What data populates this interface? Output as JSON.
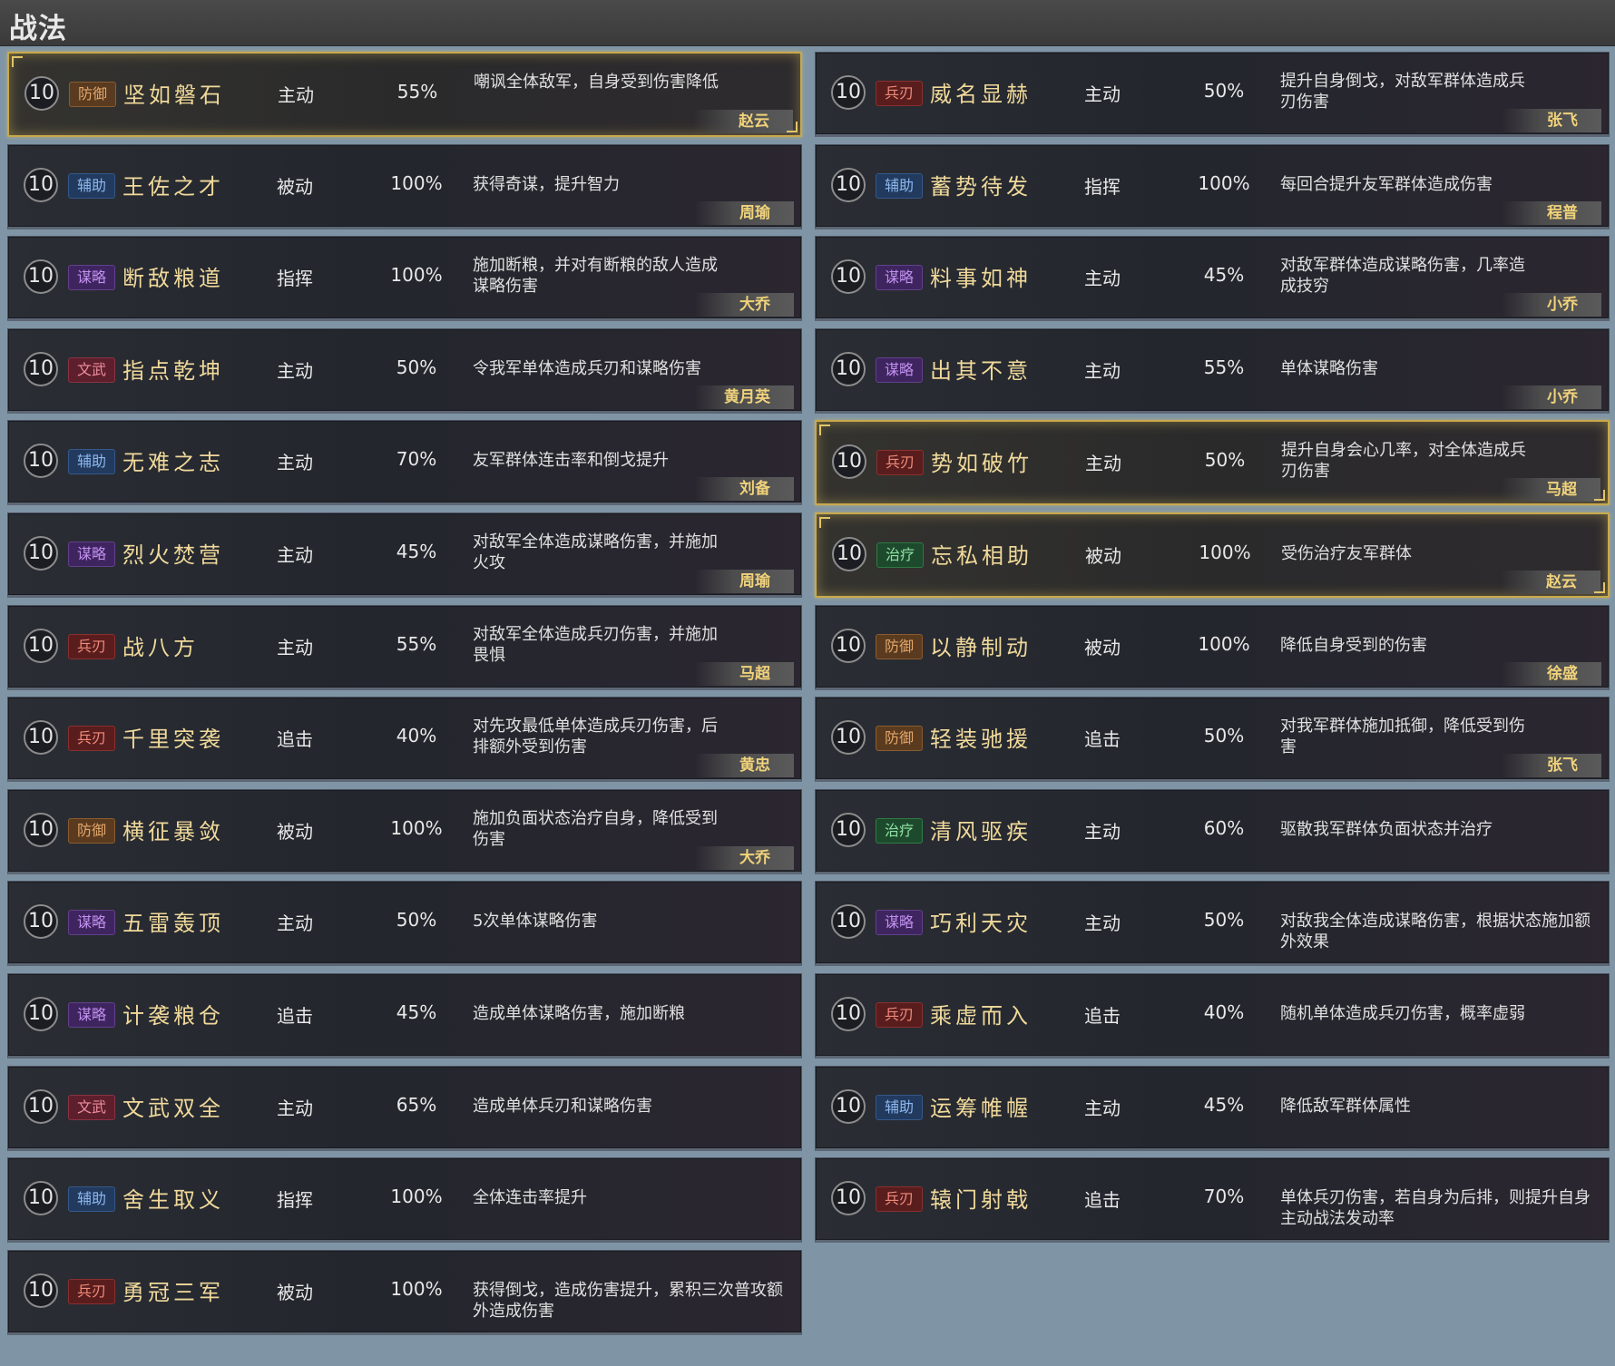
{
  "header": {
    "title": "战法"
  },
  "left": [
    {
      "level": "10",
      "tag": "防御",
      "tagKind": "fangyu",
      "name": "坚如磐石",
      "type": "主动",
      "rate": "55%",
      "desc": "嘲讽全体敌军，自身受到伤害降低",
      "hero": "赵云",
      "selected": true
    },
    {
      "level": "10",
      "tag": "辅助",
      "tagKind": "fuzhu",
      "name": "王佐之才",
      "type": "被动",
      "rate": "100%",
      "desc": "获得奇谋，提升智力",
      "hero": "周瑜",
      "selected": false
    },
    {
      "level": "10",
      "tag": "谋略",
      "tagKind": "moulue",
      "name": "断敌粮道",
      "type": "指挥",
      "rate": "100%",
      "desc": "施加断粮，并对有断粮的敌人造成谋略伤害",
      "hero": "大乔",
      "selected": false
    },
    {
      "level": "10",
      "tag": "文武",
      "tagKind": "wenwu",
      "name": "指点乾坤",
      "type": "主动",
      "rate": "50%",
      "desc": "令我军单体造成兵刃和谋略伤害",
      "hero": "黄月英",
      "selected": false
    },
    {
      "level": "10",
      "tag": "辅助",
      "tagKind": "fuzhu",
      "name": "无难之志",
      "type": "主动",
      "rate": "70%",
      "desc": "友军群体连击率和倒戈提升",
      "hero": "刘备",
      "selected": false
    },
    {
      "level": "10",
      "tag": "谋略",
      "tagKind": "moulue",
      "name": "烈火焚营",
      "type": "主动",
      "rate": "45%",
      "desc": "对敌军全体造成谋略伤害，并施加火攻",
      "hero": "周瑜",
      "selected": false
    },
    {
      "level": "10",
      "tag": "兵刃",
      "tagKind": "bingren",
      "name": "战八方",
      "type": "主动",
      "rate": "55%",
      "desc": "对敌军全体造成兵刃伤害，并施加畏惧",
      "hero": "马超",
      "selected": false
    },
    {
      "level": "10",
      "tag": "兵刃",
      "tagKind": "bingren",
      "name": "千里突袭",
      "type": "追击",
      "rate": "40%",
      "desc": "对先攻最低单体造成兵刃伤害，后排额外受到伤害",
      "hero": "黄忠",
      "selected": false
    },
    {
      "level": "10",
      "tag": "防御",
      "tagKind": "fangyu",
      "name": "横征暴敛",
      "type": "被动",
      "rate": "100%",
      "desc": "施加负面状态治疗自身，降低受到伤害",
      "hero": "大乔",
      "selected": false
    },
    {
      "level": "10",
      "tag": "谋略",
      "tagKind": "moulue",
      "name": "五雷轰顶",
      "type": "主动",
      "rate": "50%",
      "desc": "5次单体谋略伤害",
      "hero": "",
      "selected": false
    },
    {
      "level": "10",
      "tag": "谋略",
      "tagKind": "moulue",
      "name": "计袭粮仓",
      "type": "追击",
      "rate": "45%",
      "desc": "造成单体谋略伤害，施加断粮",
      "hero": "",
      "selected": false
    },
    {
      "level": "10",
      "tag": "文武",
      "tagKind": "wenwu",
      "name": "文武双全",
      "type": "主动",
      "rate": "65%",
      "desc": "造成单体兵刃和谋略伤害",
      "hero": "",
      "selected": false
    },
    {
      "level": "10",
      "tag": "辅助",
      "tagKind": "fuzhu",
      "name": "舍生取义",
      "type": "指挥",
      "rate": "100%",
      "desc": "全体连击率提升",
      "hero": "",
      "selected": false
    },
    {
      "level": "10",
      "tag": "兵刃",
      "tagKind": "bingren",
      "name": "勇冠三军",
      "type": "被动",
      "rate": "100%",
      "desc": "获得倒戈，造成伤害提升，累积三次普攻额外造成伤害",
      "hero": "",
      "selected": false
    }
  ],
  "right": [
    {
      "level": "10",
      "tag": "兵刃",
      "tagKind": "bingren",
      "name": "威名显赫",
      "type": "主动",
      "rate": "50%",
      "desc": "提升自身倒戈，对敌军群体造成兵刃伤害",
      "hero": "张飞",
      "selected": false
    },
    {
      "level": "10",
      "tag": "辅助",
      "tagKind": "fuzhu",
      "name": "蓄势待发",
      "type": "指挥",
      "rate": "100%",
      "desc": "每回合提升友军群体造成伤害",
      "hero": "程普",
      "selected": false
    },
    {
      "level": "10",
      "tag": "谋略",
      "tagKind": "moulue",
      "name": "料事如神",
      "type": "主动",
      "rate": "45%",
      "desc": "对敌军群体造成谋略伤害，几率造成技穷",
      "hero": "小乔",
      "selected": false
    },
    {
      "level": "10",
      "tag": "谋略",
      "tagKind": "moulue",
      "name": "出其不意",
      "type": "主动",
      "rate": "55%",
      "desc": "单体谋略伤害",
      "hero": "小乔",
      "selected": false
    },
    {
      "level": "10",
      "tag": "兵刃",
      "tagKind": "bingren",
      "name": "势如破竹",
      "type": "主动",
      "rate": "50%",
      "desc": "提升自身会心几率，对全体造成兵刃伤害",
      "hero": "马超",
      "selected": true
    },
    {
      "level": "10",
      "tag": "治疗",
      "tagKind": "zhiliao",
      "name": "忘私相助",
      "type": "被动",
      "rate": "100%",
      "desc": "受伤治疗友军群体",
      "hero": "赵云",
      "selected": true
    },
    {
      "level": "10",
      "tag": "防御",
      "tagKind": "fangyu",
      "name": "以静制动",
      "type": "被动",
      "rate": "100%",
      "desc": "降低自身受到的伤害",
      "hero": "徐盛",
      "selected": false
    },
    {
      "level": "10",
      "tag": "防御",
      "tagKind": "fangyu",
      "name": "轻装驰援",
      "type": "追击",
      "rate": "50%",
      "desc": "对我军群体施加抵御，降低受到伤害",
      "hero": "张飞",
      "selected": false
    },
    {
      "level": "10",
      "tag": "治疗",
      "tagKind": "zhiliao",
      "name": "清风驱疾",
      "type": "主动",
      "rate": "60%",
      "desc": "驱散我军群体负面状态并治疗",
      "hero": "",
      "selected": false
    },
    {
      "level": "10",
      "tag": "谋略",
      "tagKind": "moulue",
      "name": "巧利天灾",
      "type": "主动",
      "rate": "50%",
      "desc": "对敌我全体造成谋略伤害，根据状态施加额外效果",
      "hero": "",
      "selected": false
    },
    {
      "level": "10",
      "tag": "兵刃",
      "tagKind": "bingren",
      "name": "乘虚而入",
      "type": "追击",
      "rate": "40%",
      "desc": "随机单体造成兵刃伤害，概率虚弱",
      "hero": "",
      "selected": false
    },
    {
      "level": "10",
      "tag": "辅助",
      "tagKind": "fuzhu",
      "name": "运筹帷幄",
      "type": "主动",
      "rate": "45%",
      "desc": "降低敌军群体属性",
      "hero": "",
      "selected": false
    },
    {
      "level": "10",
      "tag": "兵刃",
      "tagKind": "bingren",
      "name": "辕门射戟",
      "type": "追击",
      "rate": "70%",
      "desc": "单体兵刃伤害，若自身为后排，则提升自身主动战法发动率",
      "hero": "",
      "selected": false
    }
  ]
}
